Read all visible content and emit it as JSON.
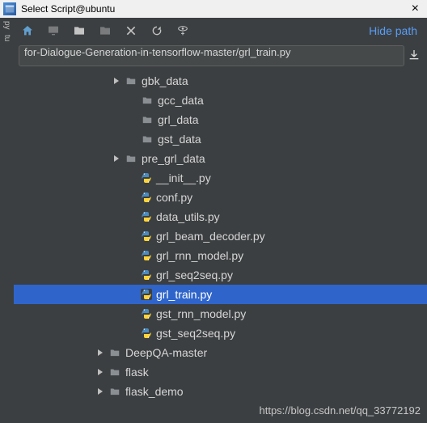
{
  "window": {
    "title": "Select Script@ubuntu"
  },
  "lefttab": {
    "t1": "py",
    "t2": "tu"
  },
  "toolbar": {
    "hide_path": "Hide path"
  },
  "path": {
    "value": "for-Dialogue-Generation-in-tensorflow-master/grl_train.py"
  },
  "tree": {
    "rows": [
      {
        "name": "gbk_data",
        "type": "folder",
        "arrow": true,
        "indent": "ind0"
      },
      {
        "name": "gcc_data",
        "type": "folder",
        "arrow": false,
        "indent": "ind1"
      },
      {
        "name": "grl_data",
        "type": "folder",
        "arrow": false,
        "indent": "ind1"
      },
      {
        "name": "gst_data",
        "type": "folder",
        "arrow": false,
        "indent": "ind1"
      },
      {
        "name": "pre_grl_data",
        "type": "folder",
        "arrow": true,
        "indent": "ind0"
      },
      {
        "name": "__init__.py",
        "type": "py",
        "arrow": false,
        "indent": "ind1"
      },
      {
        "name": "conf.py",
        "type": "py",
        "arrow": false,
        "indent": "ind1"
      },
      {
        "name": "data_utils.py",
        "type": "py",
        "arrow": false,
        "indent": "ind1"
      },
      {
        "name": "grl_beam_decoder.py",
        "type": "py",
        "arrow": false,
        "indent": "ind1"
      },
      {
        "name": "grl_rnn_model.py",
        "type": "py",
        "arrow": false,
        "indent": "ind1"
      },
      {
        "name": "grl_seq2seq.py",
        "type": "py",
        "arrow": false,
        "indent": "ind1"
      },
      {
        "name": "grl_train.py",
        "type": "py",
        "arrow": false,
        "indent": "ind1",
        "selected": true
      },
      {
        "name": "gst_rnn_model.py",
        "type": "py",
        "arrow": false,
        "indent": "ind1"
      },
      {
        "name": "gst_seq2seq.py",
        "type": "py",
        "arrow": false,
        "indent": "ind1"
      },
      {
        "name": "DeepQA-master",
        "type": "folder",
        "arrow": true,
        "indent": "indA"
      },
      {
        "name": "flask",
        "type": "folder",
        "arrow": true,
        "indent": "indA"
      },
      {
        "name": "flask_demo",
        "type": "folder",
        "arrow": true,
        "indent": "indA"
      }
    ]
  },
  "watermark": {
    "text": "https://blog.csdn.net/qq_33772192"
  }
}
